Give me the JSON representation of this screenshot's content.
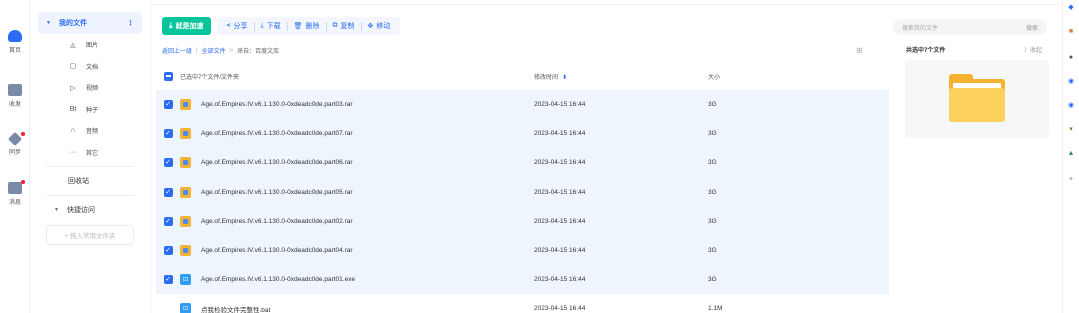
{
  "rail": [
    {
      "label": "首页",
      "icon": "cloud-icon",
      "color": "#2b6cf6"
    },
    {
      "label": "收发",
      "icon": "inbox-icon",
      "color": "#7a8aa6"
    },
    {
      "label": "同步",
      "icon": "sync-icon",
      "color": "#7a8aa6",
      "badge": true
    },
    {
      "label": "消息",
      "icon": "message-icon",
      "color": "#7a8aa6",
      "badge": true
    }
  ],
  "nav": {
    "my_files": "我的文件",
    "more": "⋮",
    "categories": [
      {
        "label": "图片",
        "icon": "image-icon",
        "glyph": "◬"
      },
      {
        "label": "文档",
        "icon": "document-icon",
        "glyph": "▢"
      },
      {
        "label": "视频",
        "icon": "video-icon",
        "glyph": "▷"
      },
      {
        "label": "种子",
        "icon": "torrent-icon",
        "glyph": "Bt"
      },
      {
        "label": "音频",
        "icon": "audio-icon",
        "glyph": "∩"
      },
      {
        "label": "其它",
        "icon": "other-icon",
        "glyph": "···"
      }
    ],
    "recycle": "回收站",
    "quick_access": "快捷访问",
    "add_folder": "+ 拖入常用文件夹"
  },
  "toolbar": {
    "primary": "就是加速",
    "actions": [
      {
        "label": "分享",
        "icon": "share-icon",
        "glyph": "⪪"
      },
      {
        "label": "下载",
        "icon": "download-icon",
        "glyph": "⤓"
      },
      {
        "label": "删除",
        "icon": "trash-icon",
        "glyph": "🗑"
      },
      {
        "label": "复制",
        "icon": "copy-icon",
        "glyph": "⧉"
      },
      {
        "label": "移动",
        "icon": "move-icon",
        "glyph": "✥"
      }
    ]
  },
  "breadcrumb": {
    "back": "返回上一级",
    "all": "全部文件",
    "current": "来自：百度文库"
  },
  "table": {
    "header_name": "已选中7个文件/文件夹",
    "header_time": "修改时间",
    "header_size": "大小",
    "rows": [
      {
        "name": "Age.of.Empires.IV.v6.1.130.0-0xdeadc0de.part03.rar",
        "time": "2023-04-15 16:44",
        "size": "3G",
        "type": "rar",
        "selected": true
      },
      {
        "name": "Age.of.Empires.IV.v6.1.130.0-0xdeadc0de.part07.rar",
        "time": "2023-04-15 16:44",
        "size": "3G",
        "type": "rar",
        "selected": true
      },
      {
        "name": "Age.of.Empires.IV.v6.1.130.0-0xdeadc0de.part06.rar",
        "time": "2023-04-15 16:44",
        "size": "3G",
        "type": "rar",
        "selected": true
      },
      {
        "name": "Age.of.Empires.IV.v6.1.130.0-0xdeadc0de.part05.rar",
        "time": "2023-04-15 16:44",
        "size": "3G",
        "type": "rar",
        "selected": true
      },
      {
        "name": "Age.of.Empires.IV.v6.1.130.0-0xdeadc0de.part02.rar",
        "time": "2023-04-15 16:44",
        "size": "3G",
        "type": "rar",
        "selected": true
      },
      {
        "name": "Age.of.Empires.IV.v6.1.130.0-0xdeadc0de.part04.rar",
        "time": "2023-04-15 16:44",
        "size": "3G",
        "type": "rar",
        "selected": true
      },
      {
        "name": "Age.of.Empires.IV.v6.1.130.0-0xdeadc0de.part01.exe",
        "time": "2023-04-15 16:44",
        "size": "3G",
        "type": "exe",
        "selected": true
      },
      {
        "name": "点我检验文件完整性.bat",
        "time": "2023-04-15 16:44",
        "size": "1.1M",
        "type": "bat",
        "selected": false
      }
    ]
  },
  "search": {
    "placeholder": "搜索我的文件",
    "button": "搜索"
  },
  "share_panel": {
    "title": "共选中7个文件",
    "collapse": "〉收起"
  },
  "colors": {
    "accent": "#2b6cf6",
    "primary_button": "#06c59a",
    "selected_row": "#eef5fd",
    "folder": "#fdd25c"
  }
}
